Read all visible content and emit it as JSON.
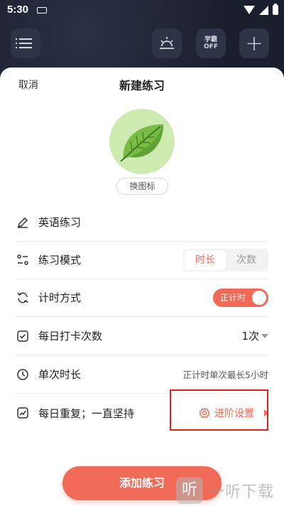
{
  "status_bar": {
    "time": "5:30"
  },
  "header": {
    "xueba_line1": "学霸",
    "xueba_line2": "OFF",
    "plus": "+"
  },
  "sheet": {
    "cancel": "取消",
    "title": "新建练习",
    "change_icon": "换图标",
    "name": "英语练习",
    "mode_label": "练习模式",
    "mode_options": [
      "时长",
      "次数"
    ],
    "mode_selected": "时长",
    "timing_label": "计时方式",
    "timing_toggle": "正计时",
    "daily_label": "每日打卡次数",
    "daily_value": "1次",
    "duration_label": "单次时长",
    "duration_value": "正计时单次最长5小时",
    "repeat_label": "每日重复；一直坚持",
    "advanced_label": "进阶设置",
    "add_button": "添加练习"
  },
  "watermark": {
    "logo": "听",
    "text": "一听下载"
  },
  "colors": {
    "accent": "#f06a57",
    "highlight": "#e02020",
    "leaf_bg": "#cdeab0"
  },
  "icons": [
    "list-icon",
    "sunset-icon",
    "plus-icon",
    "leaf-icon",
    "pencil-icon",
    "mode-icon",
    "refresh-icon",
    "checkbox-icon",
    "clock-icon",
    "chart-icon",
    "gear-icon"
  ]
}
